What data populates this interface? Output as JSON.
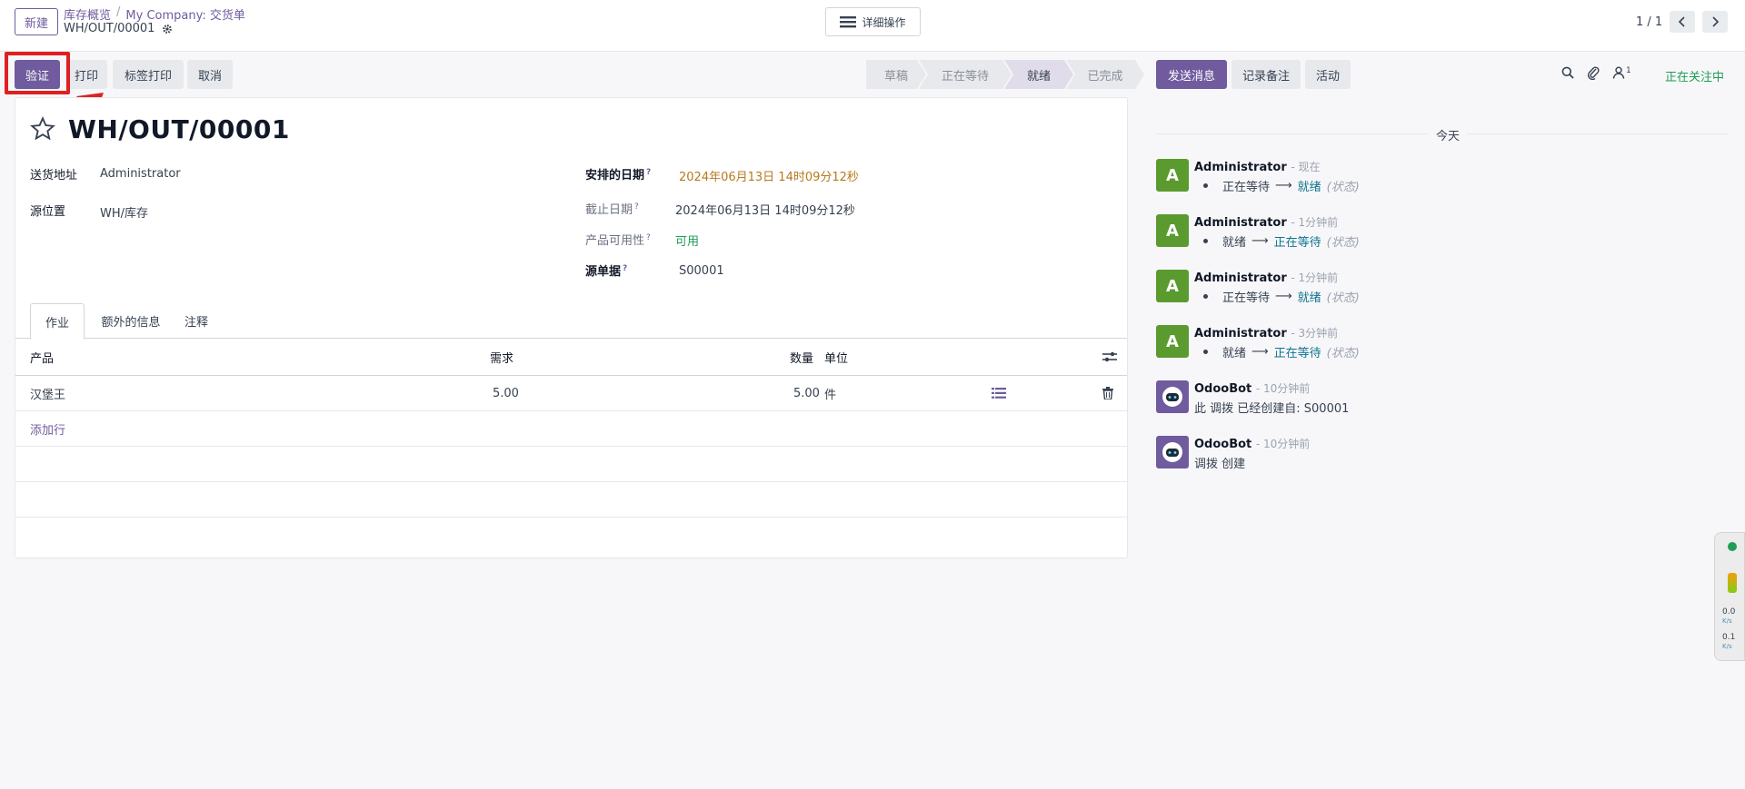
{
  "control_panel": {
    "new_button": "新建",
    "breadcrumb": [
      "库存概览",
      "My Company: 交货单"
    ],
    "breadcrumb_sep": "/",
    "record_name": "WH/OUT/00001",
    "action_menu_label": "详细操作",
    "pager": "1 / 1"
  },
  "statusbar": {
    "buttons": [
      "验证",
      "打印",
      "标签打印",
      "取消"
    ],
    "stages": [
      "草稿",
      "正在等待",
      "就绪",
      "已完成"
    ],
    "active_stage": "就绪"
  },
  "form": {
    "title": "WH/OUT/00001",
    "fields_left": [
      {
        "label": "送货地址",
        "value": "Administrator"
      },
      {
        "label": "源位置",
        "value": "WH/库存"
      }
    ],
    "fields_right": [
      {
        "label": "安排的日期",
        "help": "?",
        "value": "2024年06月13日 14时09分12秒"
      },
      {
        "label": "截止日期",
        "help": "?",
        "value": "2024年06月13日 14时09分12秒"
      },
      {
        "label": "产品可用性",
        "help": "?",
        "value": "可用"
      },
      {
        "label": "源单据",
        "help": "?",
        "value": "S00001"
      }
    ],
    "tabs": [
      "作业",
      "额外的信息",
      "注释"
    ],
    "table": {
      "columns": [
        "产品",
        "需求",
        "数量",
        "单位"
      ],
      "rows": [
        {
          "product": "汉堡王",
          "demand": "5.00",
          "quantity": "5.00",
          "uom": "件"
        }
      ],
      "add_line": "添加行"
    }
  },
  "chatter": {
    "buttons": [
      "发送消息",
      "记录备注",
      "活动"
    ],
    "follower_count": "1",
    "following": "正在关注中",
    "day": "今天",
    "messages": [
      {
        "avatar": "A",
        "author": "Administrator",
        "time": "- 现在",
        "old": "正在等待",
        "arrow": "⟶",
        "new": "就绪",
        "field": "(状态)"
      },
      {
        "avatar": "A",
        "author": "Administrator",
        "time": "- 1分钟前",
        "old": "就绪",
        "arrow": "⟶",
        "new": "正在等待",
        "field": "(状态)"
      },
      {
        "avatar": "A",
        "author": "Administrator",
        "time": "- 1分钟前",
        "old": "正在等待",
        "arrow": "⟶",
        "new": "就绪",
        "field": "(状态)"
      },
      {
        "avatar": "A",
        "author": "Administrator",
        "time": "- 3分钟前",
        "old": "就绪",
        "arrow": "⟶",
        "new": "正在等待",
        "field": "(状态)"
      },
      {
        "author": "OdooBot",
        "time": "- 10分钟前",
        "text": "此 调拨 已经创建自: S00001"
      },
      {
        "author": "OdooBot",
        "time": "- 10分钟前",
        "text": "调拨 创建"
      }
    ]
  },
  "net_widget": {
    "down": "0.0",
    "down_unit": "K/s",
    "up": "0.1",
    "up_unit": "K/s"
  },
  "colors": {
    "primary": "#6f5b9e",
    "highlight": "#e02020",
    "success": "#1f9d55",
    "date_warning": "#b7791f"
  }
}
